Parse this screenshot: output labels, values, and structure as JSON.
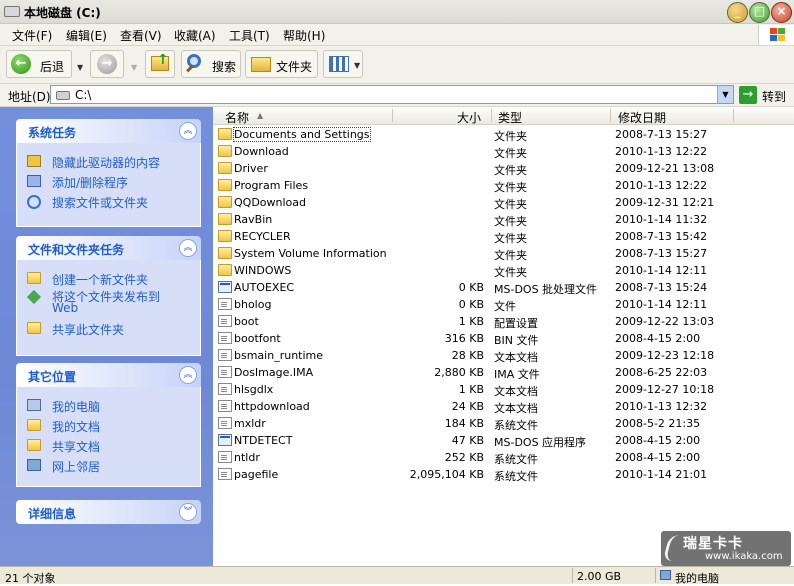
{
  "window": {
    "title": "本地磁盘 (C:)",
    "min": "_",
    "max": "□",
    "close": "×"
  },
  "menu": [
    "文件(F)",
    "编辑(E)",
    "查看(V)",
    "收藏(A)",
    "工具(T)",
    "帮助(H)"
  ],
  "toolbar": {
    "back": "后退",
    "search": "搜索",
    "folders": "文件夹"
  },
  "address": {
    "label": "地址(D)",
    "value": "C:\\",
    "go": "转到"
  },
  "taskpane": {
    "system_tasks": {
      "title": "系统任务",
      "items": [
        "隐藏此驱动器的内容",
        "添加/删除程序",
        "搜索文件或文件夹"
      ]
    },
    "file_tasks": {
      "title": "文件和文件夹任务",
      "items": [
        "创建一个新文件夹",
        "将这个文件夹发布到",
        "Web",
        "共享此文件夹"
      ]
    },
    "other_places": {
      "title": "其它位置",
      "items": [
        "我的电脑",
        "我的文档",
        "共享文档",
        "网上邻居"
      ]
    },
    "details": {
      "title": "详细信息"
    }
  },
  "columns": {
    "name": "名称",
    "size": "大小",
    "type": "类型",
    "modified": "修改日期"
  },
  "files": [
    {
      "name": "Documents and Settings",
      "size": "",
      "type": "文件夹",
      "modified": "2008-7-13 15:27",
      "kind": "folder"
    },
    {
      "name": "Download",
      "size": "",
      "type": "文件夹",
      "modified": "2010-1-13 12:22",
      "kind": "folder"
    },
    {
      "name": "Driver",
      "size": "",
      "type": "文件夹",
      "modified": "2009-12-21 13:08",
      "kind": "folder"
    },
    {
      "name": "Program Files",
      "size": "",
      "type": "文件夹",
      "modified": "2010-1-13 12:22",
      "kind": "folder"
    },
    {
      "name": "QQDownload",
      "size": "",
      "type": "文件夹",
      "modified": "2009-12-31 12:21",
      "kind": "folder"
    },
    {
      "name": "RavBin",
      "size": "",
      "type": "文件夹",
      "modified": "2010-1-14 11:32",
      "kind": "folder"
    },
    {
      "name": "RECYCLER",
      "size": "",
      "type": "文件夹",
      "modified": "2008-7-13 15:42",
      "kind": "folder"
    },
    {
      "name": "System Volume Information",
      "size": "",
      "type": "文件夹",
      "modified": "2008-7-13 15:27",
      "kind": "folder"
    },
    {
      "name": "WINDOWS",
      "size": "",
      "type": "文件夹",
      "modified": "2010-1-14 12:11",
      "kind": "folder"
    },
    {
      "name": "AUTOEXEC",
      "size": "0 KB",
      "type": "MS-DOS 批处理文件",
      "modified": "2008-7-13 15:24",
      "kind": "exe"
    },
    {
      "name": "bholog",
      "size": "0 KB",
      "type": "文件",
      "modified": "2010-1-14 12:11",
      "kind": "doc"
    },
    {
      "name": "boot",
      "size": "1 KB",
      "type": "配置设置",
      "modified": "2009-12-22 13:03",
      "kind": "doc"
    },
    {
      "name": "bootfont",
      "size": "316 KB",
      "type": "BIN 文件",
      "modified": "2008-4-15 2:00",
      "kind": "doc"
    },
    {
      "name": "bsmain_runtime",
      "size": "28 KB",
      "type": "文本文档",
      "modified": "2009-12-23 12:18",
      "kind": "doc"
    },
    {
      "name": "DosImage.IMA",
      "size": "2,880 KB",
      "type": "IMA 文件",
      "modified": "2008-6-25 22:03",
      "kind": "doc"
    },
    {
      "name": "hlsgdlx",
      "size": "1 KB",
      "type": "文本文档",
      "modified": "2009-12-27 10:18",
      "kind": "doc"
    },
    {
      "name": "httpdownload",
      "size": "24 KB",
      "type": "文本文档",
      "modified": "2010-1-13 12:32",
      "kind": "doc"
    },
    {
      "name": "mxldr",
      "size": "184 KB",
      "type": "系统文件",
      "modified": "2008-5-2 21:35",
      "kind": "doc"
    },
    {
      "name": "NTDETECT",
      "size": "47 KB",
      "type": "MS-DOS 应用程序",
      "modified": "2008-4-15 2:00",
      "kind": "exe"
    },
    {
      "name": "ntldr",
      "size": "252 KB",
      "type": "系统文件",
      "modified": "2008-4-15 2:00",
      "kind": "doc"
    },
    {
      "name": "pagefile",
      "size": "2,095,104 KB",
      "type": "系统文件",
      "modified": "2010-1-14 21:01",
      "kind": "doc"
    }
  ],
  "status": {
    "count": "21 个对象",
    "size": "2.00 GB",
    "location": "我的电脑"
  },
  "watermark": {
    "brand": "瑞星卡卡",
    "url": "www.ikaka.com"
  }
}
